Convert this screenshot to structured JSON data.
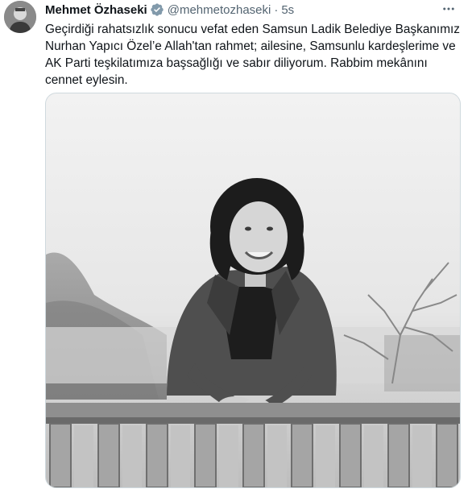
{
  "tweet": {
    "author_name": "Mehmet Özhaseki",
    "handle": "@mehmetozhaseki",
    "separator": "·",
    "time": "5s",
    "text": "Geçirdiği rahatsızlık sonucu vefat eden Samsun Ladik Belediye Başkanımız\nNurhan Yapıcı Özel’e Allah'tan rahmet; ailesine, Samsunlu kardeşlerime ve\nAK Parti teşkilatımıza başsağlığı ve sabır diliyorum. Rabbim mekânını\ncennet eylesin.",
    "icons": {
      "verified": "verified-badge-icon",
      "more": "more-options-icon"
    },
    "colors": {
      "verified_badge": "#829aab",
      "secondary_text": "#536471",
      "primary_text": "#0f1419"
    }
  }
}
